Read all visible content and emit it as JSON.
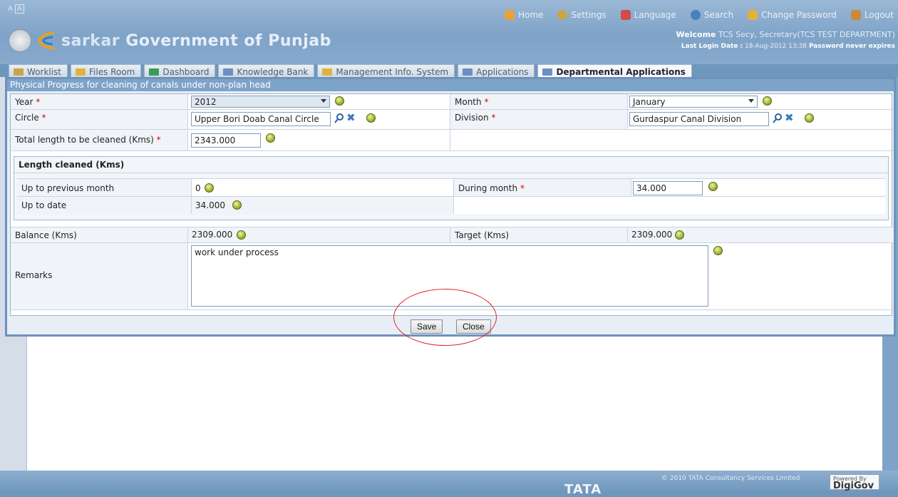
{
  "font_size_controls": [
    "A",
    "A"
  ],
  "top_nav": [
    {
      "label": "Home",
      "icon": "home-icon",
      "color": "#e6a23c"
    },
    {
      "label": "Settings",
      "icon": "gear-icon",
      "color": "#c9a54a"
    },
    {
      "label": "Language",
      "icon": "language-icon",
      "color": "#d14b4b"
    },
    {
      "label": "Search",
      "icon": "search-icon",
      "color": "#4a7fc1"
    },
    {
      "label": "Change Password",
      "icon": "key-icon",
      "color": "#e0b23d"
    },
    {
      "label": "Logout",
      "icon": "logout-icon",
      "color": "#c98a3a"
    }
  ],
  "brand": {
    "sarkar": "sarkar",
    "title": "Government of Punjab"
  },
  "welcome": {
    "prefix": "Welcome",
    "user": "TCS Secy, Secretary(TCS TEST DEPARTMENT)",
    "last_login_label": "Last Login Date :",
    "last_login_value": "18-Aug-2012 13:38",
    "password_note": "Password never expires"
  },
  "tabs": [
    {
      "label": "Worklist",
      "color": "#c9a54a"
    },
    {
      "label": "Files Room",
      "color": "#e0b23d"
    },
    {
      "label": "Dashboard",
      "color": "#3a9a5a"
    },
    {
      "label": "Knowledge Bank",
      "color": "#6b8fc1"
    },
    {
      "label": "Management Info. System",
      "color": "#e0b23d"
    },
    {
      "label": "Applications",
      "color": "#6b8fc1"
    },
    {
      "label": "Departmental Applications",
      "color": "#6b8fc1",
      "active": true
    }
  ],
  "dialog": {
    "title": "Physical Progress for cleaning of canals under non-plan head",
    "fields": {
      "year": {
        "label": "Year",
        "value": "2012"
      },
      "month": {
        "label": "Month",
        "value": "January"
      },
      "circle": {
        "label": "Circle",
        "value": "Upper Bori Doab Canal  Circle"
      },
      "division": {
        "label": "Division",
        "value": "Gurdaspur Canal Division"
      },
      "total_length": {
        "label": "Total length to be cleaned (Kms)",
        "value": "2343.000"
      },
      "length_cleaned_heading": "Length cleaned (Kms)",
      "up_to_prev": {
        "label": "Up to previous month",
        "value": "0"
      },
      "during_month": {
        "label": "During month",
        "value": "34.000"
      },
      "up_to_date": {
        "label": "Up to date",
        "value": "34.000"
      },
      "balance": {
        "label": "Balance (Kms)",
        "value": "2309.000"
      },
      "target": {
        "label": "Target (Kms)",
        "value": "2309.000"
      },
      "remarks": {
        "label": "Remarks",
        "value": "work under process"
      }
    },
    "required_mark": "*",
    "buttons": {
      "save": "Save",
      "close": "Close"
    }
  },
  "footer": {
    "brand": "TATA",
    "copyright": "© 2010 TATA Consultancy Services Limited",
    "powered_by": "Powered By",
    "product": "DigiGov"
  }
}
